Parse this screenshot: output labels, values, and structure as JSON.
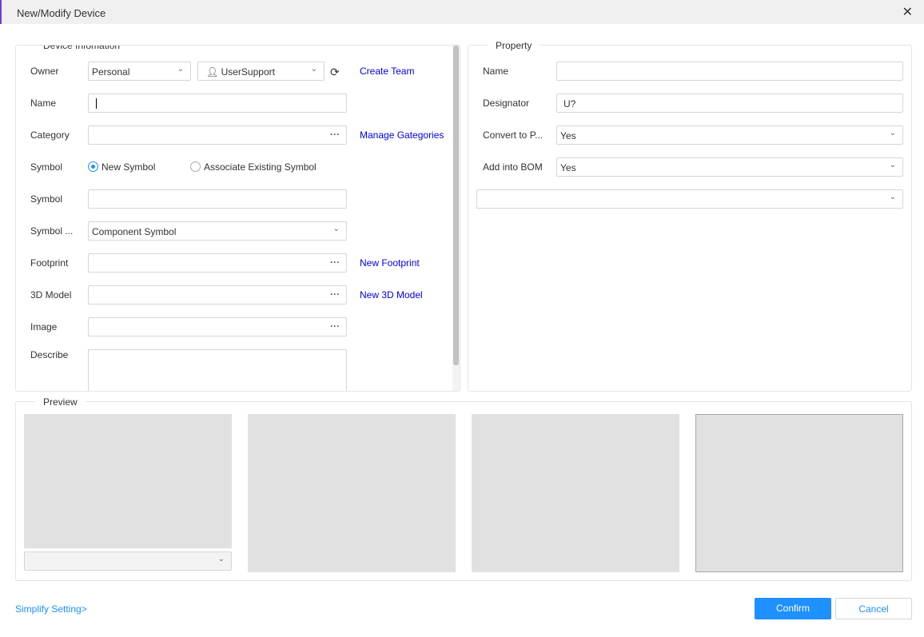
{
  "window": {
    "title": "New/Modify Device",
    "close_icon": "close-icon"
  },
  "device_info": {
    "legend": "Device Infomation",
    "owner": {
      "label": "Owner",
      "type_value": "Personal",
      "user_value": "UserSupport",
      "create_team": "Create Team"
    },
    "name": {
      "label": "Name",
      "value": ""
    },
    "category": {
      "label": "Category",
      "value": "",
      "manage": "Manage Gategories"
    },
    "symbol_mode": {
      "label": "Symbol",
      "options": [
        "New Symbol",
        "Associate Existing Symbol"
      ],
      "selected": "New Symbol"
    },
    "symbol": {
      "label": "Symbol",
      "value": ""
    },
    "symbol_type": {
      "label": "Symbol ...",
      "value": "Component Symbol"
    },
    "footprint": {
      "label": "Footprint",
      "value": "",
      "new": "New Footprint"
    },
    "model3d": {
      "label": "3D Model",
      "value": "",
      "new": "New 3D Model"
    },
    "image": {
      "label": "Image",
      "value": ""
    },
    "describe": {
      "label": "Describe",
      "value": ""
    }
  },
  "property": {
    "legend": "Property",
    "name": {
      "label": "Name",
      "value": ""
    },
    "designator": {
      "label": "Designator",
      "value": "U?"
    },
    "convert": {
      "label": "Convert to P...",
      "value": "Yes"
    },
    "bom": {
      "label": "Add into BOM",
      "value": "Yes"
    },
    "extra": {
      "value": ""
    }
  },
  "preview": {
    "legend": "Preview",
    "select_value": ""
  },
  "footer": {
    "simplify": "Simplify Setting>",
    "confirm": "Confirm",
    "cancel": "Cancel"
  },
  "colors": {
    "accent": "#1e90ff",
    "link": "#0000ee"
  }
}
